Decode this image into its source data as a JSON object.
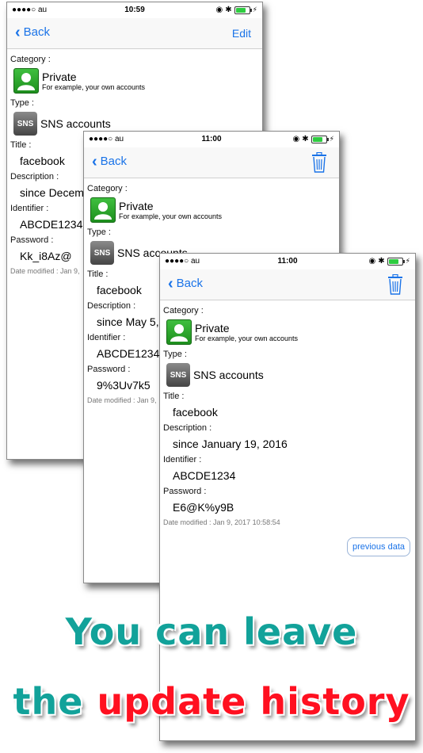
{
  "status": {
    "carrier": "●●●●○ au",
    "card1_time": "10:59",
    "card2_time": "11:00",
    "card3_time": "11:00"
  },
  "nav": {
    "back_label": "Back",
    "edit_label": "Edit"
  },
  "labels": {
    "category": "Category :",
    "type": "Type :",
    "title": "Title :",
    "description": "Description :",
    "identifier": "Identifier :",
    "password": "Password :"
  },
  "category": {
    "name": "Private",
    "subtitle": "For example, your own accounts"
  },
  "type": {
    "icon_text": "SNS",
    "name": "SNS accounts"
  },
  "card1": {
    "title": "facebook",
    "description": "since Decem",
    "identifier": "ABCDE1234",
    "password": "Kk_i8Az@",
    "modified": "Date modified : Jan 9,"
  },
  "card2": {
    "title": "facebook",
    "description": "since May 5,",
    "identifier": "ABCDE1234",
    "password": "9%3Uv7k5",
    "modified": "Date modified : Jan 9,"
  },
  "card3": {
    "title": "facebook",
    "description": "since January 19, 2016",
    "identifier": "ABCDE1234",
    "password": "E6@K%y9B",
    "modified": "Date modified : Jan 9, 2017 10:58:54",
    "previous_button": "previous data"
  },
  "tagline": {
    "line1": "You can leave",
    "line2_a": "the",
    "line2_b": "update history"
  },
  "colors": {
    "accent": "#1a73e8",
    "teal": "#12a29a",
    "red": "#ff1020"
  }
}
